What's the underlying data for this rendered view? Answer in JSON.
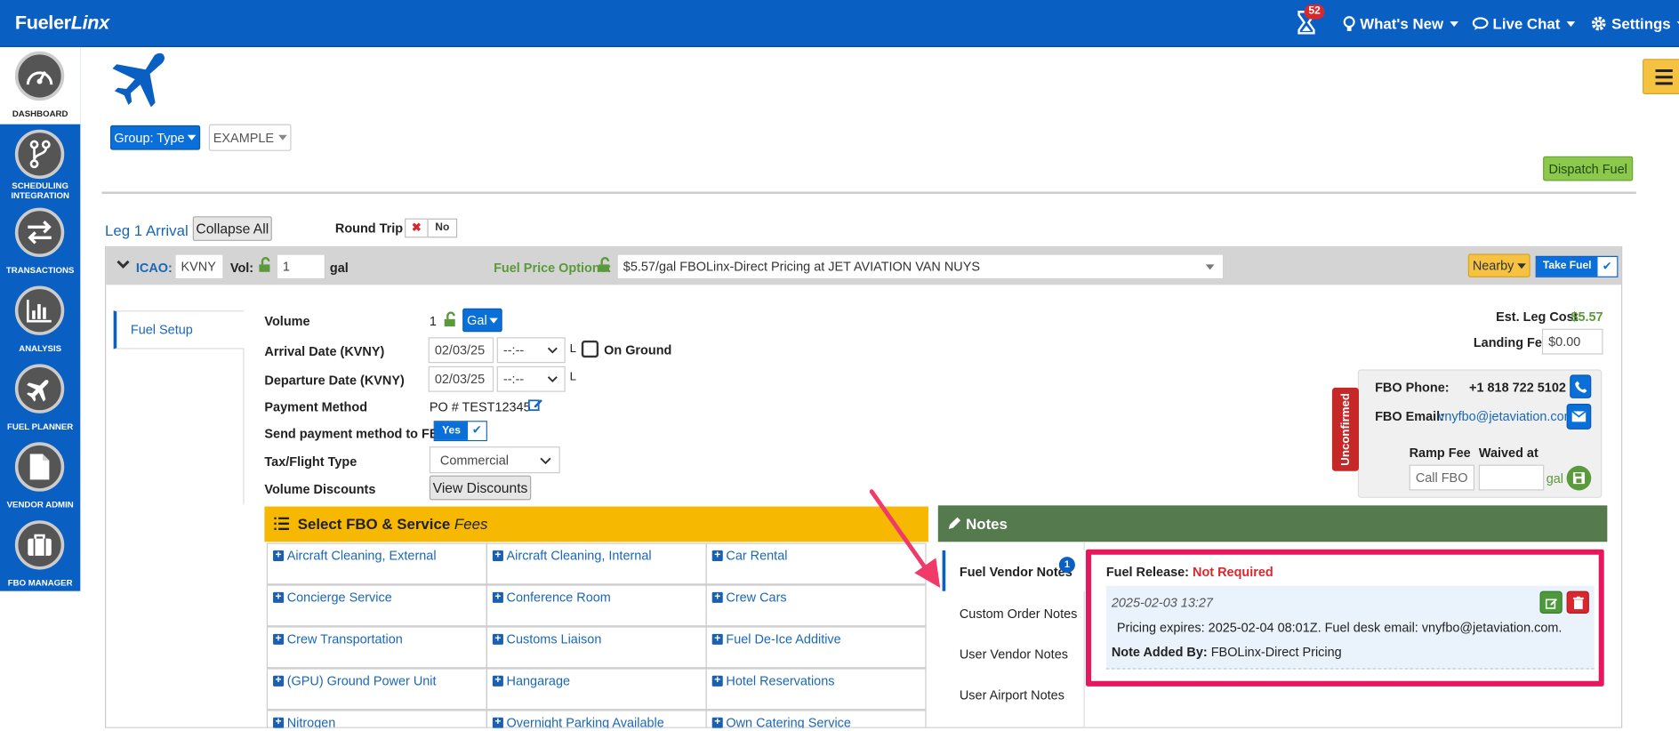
{
  "header": {
    "logo_a": "Fueler",
    "logo_b": "Linx",
    "notifications_count": "52",
    "whats_new": "What's New",
    "live_chat": "Live Chat",
    "settings": "Settings"
  },
  "sidebar": {
    "items": [
      {
        "label": "DASHBOARD",
        "icon": "dashboard-gauge-icon"
      },
      {
        "label": "SCHEDULING\nINTEGRATION",
        "icon": "scheduling-branch-icon"
      },
      {
        "label": "TRANSACTIONS",
        "icon": "transactions-arrows-icon"
      },
      {
        "label": "ANALYSIS",
        "icon": "analysis-chart-icon"
      },
      {
        "label": "FUEL PLANNER",
        "icon": "fuel-planner-plane-icon"
      },
      {
        "label": "VENDOR ADMIN",
        "icon": "vendor-document-icon"
      },
      {
        "label": "FBO MANAGER",
        "icon": "fbo-briefcase-icon"
      }
    ]
  },
  "toolbar": {
    "group_type": "Group: Type",
    "example": "EXAMPLE",
    "dispatch_fuel": "Dispatch Fuel"
  },
  "leg": {
    "title": "Leg 1 Arrival",
    "collapse_all": "Collapse All",
    "round_trip_label": "Round Trip",
    "round_trip_value": "No",
    "icao_label": "ICAO:",
    "icao_value": "KVNY",
    "vol_label": "Vol:",
    "vol_value": "1",
    "vol_unit": "gal",
    "fuel_price_label": "Fuel Price Options:",
    "fuel_price_value": "$5.57/gal FBOLinx-Direct Pricing at JET AVIATION VAN NUYS",
    "nearby": "Nearby",
    "take_fuel": "Take Fuel"
  },
  "fuel_setup": {
    "tab": "Fuel Setup",
    "volume_label": "Volume",
    "volume_value": "1",
    "volume_unit": "Gal",
    "arrival_label": "Arrival Date (KVNY)",
    "arrival_date": "02/03/25",
    "arrival_time": "--:--",
    "arrival_l": "L",
    "on_ground": "On Ground",
    "departure_label": "Departure Date (KVNY)",
    "departure_date": "02/03/25",
    "departure_time": "--:--",
    "departure_l": "L",
    "payment_label": "Payment Method",
    "payment_value": "PO # TEST12345",
    "send_payment_label": "Send payment method to FBO",
    "send_payment_value": "Yes",
    "tax_label": "Tax/Flight Type",
    "tax_value": "Commercial",
    "discounts_label": "Volume Discounts",
    "view_discounts": "View Discounts"
  },
  "costs": {
    "est_leg_cost_label": "Est. Leg Cost",
    "est_leg_cost_value": "$5.57",
    "landing_fee_label": "Landing Fee",
    "landing_fee_value": "$0.00"
  },
  "fbo": {
    "status": "Unconfirmed",
    "phone_label": "FBO Phone:",
    "phone_value": "+1 818 722 5102",
    "email_label": "FBO Email:",
    "email_value": "vnyfbo@jetaviation.com",
    "ramp_fee_label": "Ramp Fee",
    "waived_label": "Waived at",
    "ramp_fee_value": "Call FBO",
    "waived_unit": "gal"
  },
  "services": {
    "title": "Select FBO & Service",
    "title_em": "Fees",
    "items": [
      "Aircraft Cleaning, External",
      "Aircraft Cleaning, Internal",
      "Car Rental",
      "Concierge Service",
      "Conference Room",
      "Crew Cars",
      "Crew Transportation",
      "Customs Liaison",
      "Fuel De-Ice Additive",
      "(GPU) Ground Power Unit",
      "Hangarage",
      "Hotel Reservations",
      "Nitrogen",
      "Overnight Parking Available",
      "Own Catering Service"
    ]
  },
  "notes": {
    "title": "Notes",
    "tabs": [
      "Fuel Vendor Notes",
      "Custom Order Notes",
      "User Vendor Notes",
      "User Airport Notes"
    ],
    "vendor_badge": "1",
    "fuel_release_label": "Fuel Release:",
    "fuel_release_value": "Not Required",
    "note_time": "2025-02-03 13:27",
    "note_text": "Pricing expires: 2025-02-04 08:01Z. Fuel desk email: vnyfbo@jetaviation.com.",
    "added_by_label": "Note Added By:",
    "added_by_value": "FBOLinx-Direct Pricing"
  },
  "colors": {
    "brand": "#0a5fc2",
    "notes_header": "#557a4e",
    "services_header": "#f6b800",
    "highlight": "#e8175d",
    "arrow": "#ef3a6a",
    "danger": "#d9272e"
  }
}
